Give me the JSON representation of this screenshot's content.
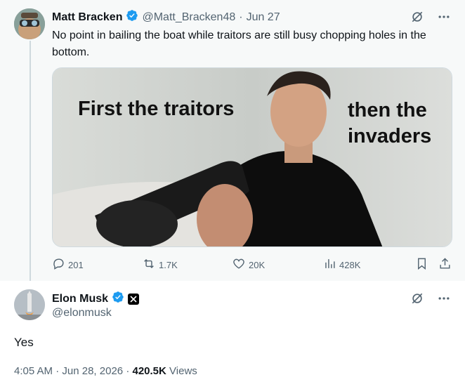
{
  "quoted_tweet": {
    "author_name": "Matt Bracken",
    "handle": "@Matt_Bracken48",
    "separator": "·",
    "date": "Jun 27",
    "text": "No point in bailing the boat while traitors are still busy chopping holes in the bottom.",
    "image": {
      "left_caption": "First the traitors",
      "right_caption": "then the invaders"
    },
    "stats": {
      "replies": "201",
      "reposts": "1.7K",
      "likes": "20K",
      "views": "428K"
    }
  },
  "main_tweet": {
    "author_name": "Elon Musk",
    "handle": "@elonmusk",
    "text": "Yes",
    "time": "4:05 AM",
    "date": "Jun 28, 2026",
    "dot": "·",
    "views_count": "420.5K",
    "views_label": "Views"
  },
  "colors": {
    "verified_blue": "#1d9bf0",
    "muted": "#536471",
    "text": "#0f1419"
  }
}
